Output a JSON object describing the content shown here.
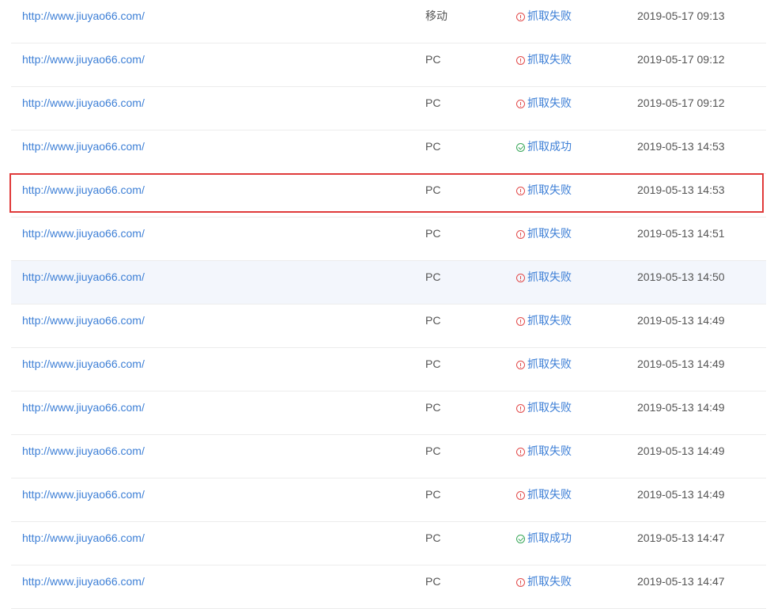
{
  "rows": [
    {
      "url": "http://www.jiuyao66.com/",
      "ua": "移动",
      "status": "抓取失败",
      "status_type": "fail",
      "time": "2019-05-17 09:13"
    },
    {
      "url": "http://www.jiuyao66.com/",
      "ua": "PC",
      "status": "抓取失败",
      "status_type": "fail",
      "time": "2019-05-17 09:12"
    },
    {
      "url": "http://www.jiuyao66.com/",
      "ua": "PC",
      "status": "抓取失败",
      "status_type": "fail",
      "time": "2019-05-17 09:12"
    },
    {
      "url": "http://www.jiuyao66.com/",
      "ua": "PC",
      "status": "抓取成功",
      "status_type": "ok",
      "time": "2019-05-13 14:53"
    },
    {
      "url": "http://www.jiuyao66.com/",
      "ua": "PC",
      "status": "抓取失败",
      "status_type": "fail",
      "time": "2019-05-13 14:53"
    },
    {
      "url": "http://www.jiuyao66.com/",
      "ua": "PC",
      "status": "抓取失败",
      "status_type": "fail",
      "time": "2019-05-13 14:51"
    },
    {
      "url": "http://www.jiuyao66.com/",
      "ua": "PC",
      "status": "抓取失败",
      "status_type": "fail",
      "time": "2019-05-13 14:50"
    },
    {
      "url": "http://www.jiuyao66.com/",
      "ua": "PC",
      "status": "抓取失败",
      "status_type": "fail",
      "time": "2019-05-13 14:49"
    },
    {
      "url": "http://www.jiuyao66.com/",
      "ua": "PC",
      "status": "抓取失败",
      "status_type": "fail",
      "time": "2019-05-13 14:49"
    },
    {
      "url": "http://www.jiuyao66.com/",
      "ua": "PC",
      "status": "抓取失败",
      "status_type": "fail",
      "time": "2019-05-13 14:49"
    },
    {
      "url": "http://www.jiuyao66.com/",
      "ua": "PC",
      "status": "抓取失败",
      "status_type": "fail",
      "time": "2019-05-13 14:49"
    },
    {
      "url": "http://www.jiuyao66.com/",
      "ua": "PC",
      "status": "抓取失败",
      "status_type": "fail",
      "time": "2019-05-13 14:49"
    },
    {
      "url": "http://www.jiuyao66.com/",
      "ua": "PC",
      "status": "抓取成功",
      "status_type": "ok",
      "time": "2019-05-13 14:47"
    },
    {
      "url": "http://www.jiuyao66.com/",
      "ua": "PC",
      "status": "抓取失败",
      "status_type": "fail",
      "time": "2019-05-13 14:47"
    }
  ],
  "colors": {
    "link": "#3d7fd6",
    "fail_icon": "#e24b4b",
    "ok_icon": "#3aa85a",
    "highlight": "#e03a3a",
    "hover_row": "#f3f6fc"
  },
  "icons": {
    "fail": "exclamation-circle-icon",
    "ok": "check-circle-icon"
  }
}
